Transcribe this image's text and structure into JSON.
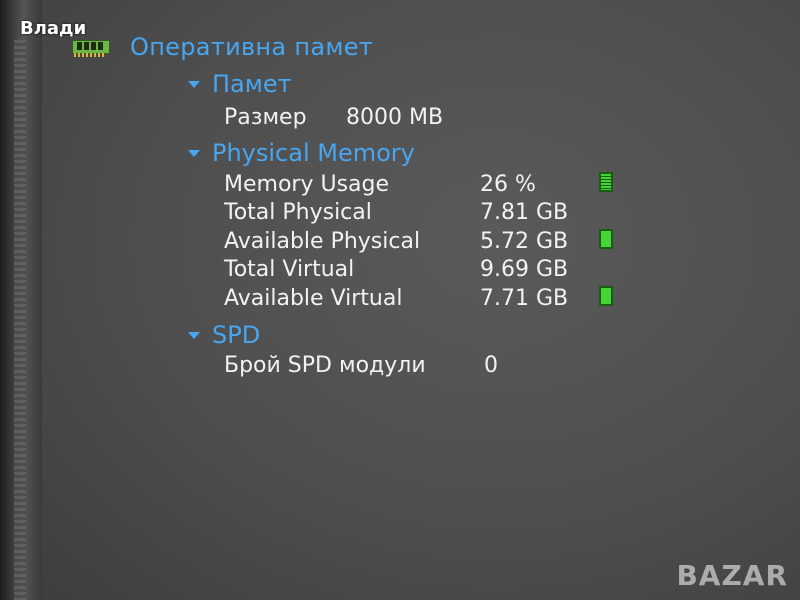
{
  "overlay": {
    "user_name": "Влади",
    "watermark": "BAZAR"
  },
  "tree": {
    "root": {
      "label": "Оперативна памет",
      "icon": "ram-module-icon"
    },
    "sections": [
      {
        "label": "Памет",
        "rows": [
          {
            "name": "Размер",
            "value": "8000 MB"
          }
        ]
      },
      {
        "label": "Physical Memory",
        "rows": [
          {
            "name": "Memory Usage",
            "value": "26 %",
            "icon": "usage-bar-icon"
          },
          {
            "name": "Total Physical",
            "value": "7.81 GB"
          },
          {
            "name": "Available Physical",
            "value": "5.72 GB",
            "icon": "usage-bar-icon"
          },
          {
            "name": "Total Virtual",
            "value": "9.69 GB"
          },
          {
            "name": "Available Virtual",
            "value": "7.71 GB",
            "icon": "usage-bar-icon"
          }
        ]
      },
      {
        "label": "SPD",
        "rows": [
          {
            "name": "Брой SPD модули",
            "value": "0"
          }
        ]
      }
    ]
  },
  "colors": {
    "section_text": "#48a6f0",
    "value_text": "#f2f2f2",
    "bar_fill": "#44d637"
  }
}
